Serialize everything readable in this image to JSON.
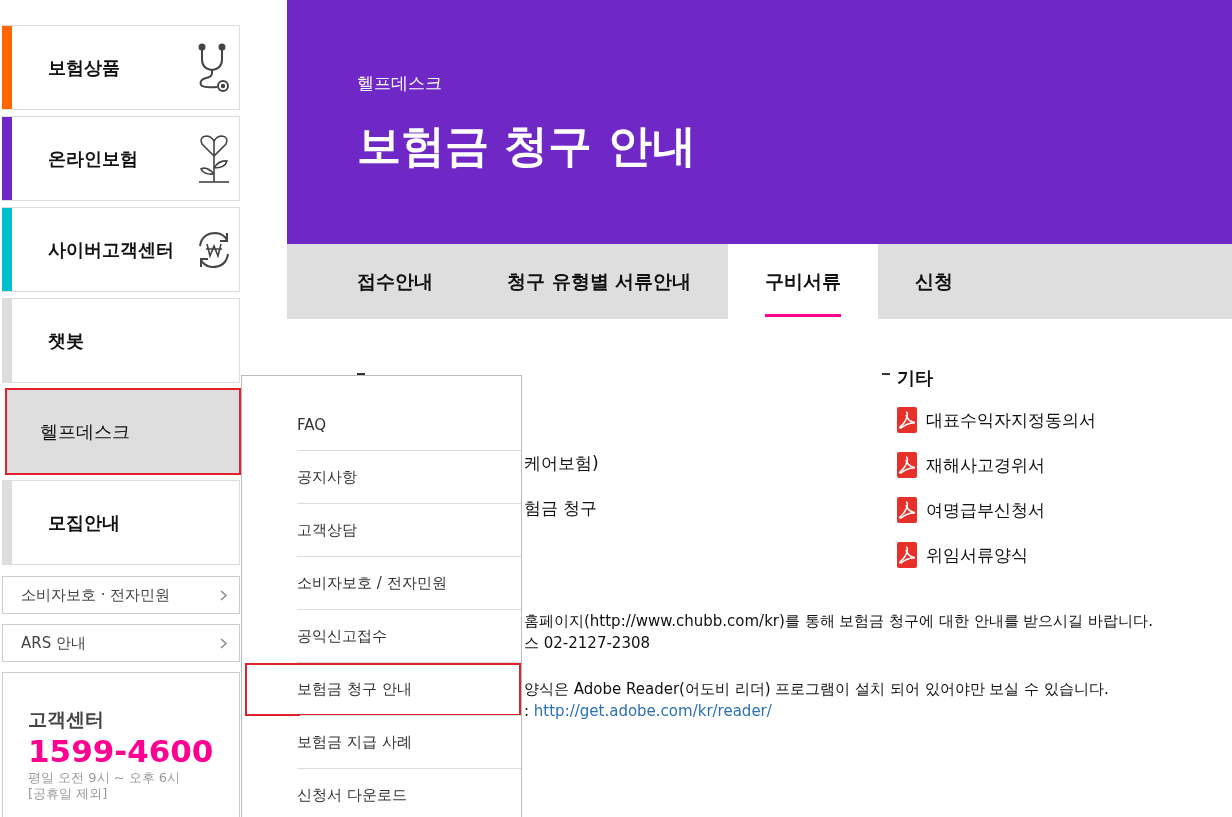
{
  "sidebar": {
    "items": [
      {
        "label": "보험상품",
        "color": "#ff6600",
        "selected": false
      },
      {
        "label": "온라인보험",
        "color": "#6e26c4",
        "selected": false
      },
      {
        "label": "사이버고객센터",
        "color": "#00c0d0",
        "selected": false
      },
      {
        "label": "챗봇",
        "color": "#dddddd",
        "selected": false
      },
      {
        "label": "헬프데스크",
        "selected": true
      },
      {
        "label": "모집안내",
        "color": "#dddddd",
        "selected": false
      }
    ],
    "links": [
      "소비자보호 · 전자민원",
      "ARS 안내"
    ],
    "customer_center": {
      "title": "고객센터",
      "phone": "1599-4600",
      "hours": [
        "평일 오전 9시 ~ 오후 6시",
        "[공휴일 제외]"
      ]
    }
  },
  "header": {
    "breadcrumb": "헬프데스크",
    "title": "보험금 청구 안내"
  },
  "tabs": [
    {
      "label": "접수안내",
      "selected": false
    },
    {
      "label": "청구 유형별 서류안내",
      "selected": false
    },
    {
      "label": "구비서류",
      "selected": true
    },
    {
      "label": "신청",
      "selected": false
    }
  ],
  "content": {
    "left": {
      "lines": [
        "케어보험)",
        "험금 청구"
      ]
    },
    "right": {
      "heading": "기타",
      "files": [
        "대표수익자지정동의서",
        "재해사고경위서",
        "여명급부신청서",
        "위임서류양식"
      ]
    },
    "notes": [
      [
        {
          "text": "홈페이지(http://www.chubb.com/kr)를 통해 보험금 청구에 대한 안내를 받으시길 바랍니다."
        },
        {
          "text": "스 02-2127-2308"
        }
      ],
      [
        {
          "text": "양식은 Adobe Reader(어도비 리더) 프로그램이 설치 되어 있어야만 보실 수 있습니다."
        },
        {
          "text": ":",
          "link": "http://get.adobe.com/kr/reader/"
        }
      ]
    ]
  },
  "dropdown": {
    "items": [
      {
        "label": "FAQ",
        "selected": false
      },
      {
        "label": "공지사항",
        "selected": false
      },
      {
        "label": "고객상담",
        "selected": false
      },
      {
        "label": "소비자보호 / 전자민원",
        "selected": false
      },
      {
        "label": "공익신고접수",
        "selected": false
      },
      {
        "label": "보험금 청구 안내",
        "selected": true
      },
      {
        "label": "보험금 지급 사례",
        "selected": false
      },
      {
        "label": "신청서 다운로드",
        "selected": false
      }
    ]
  }
}
